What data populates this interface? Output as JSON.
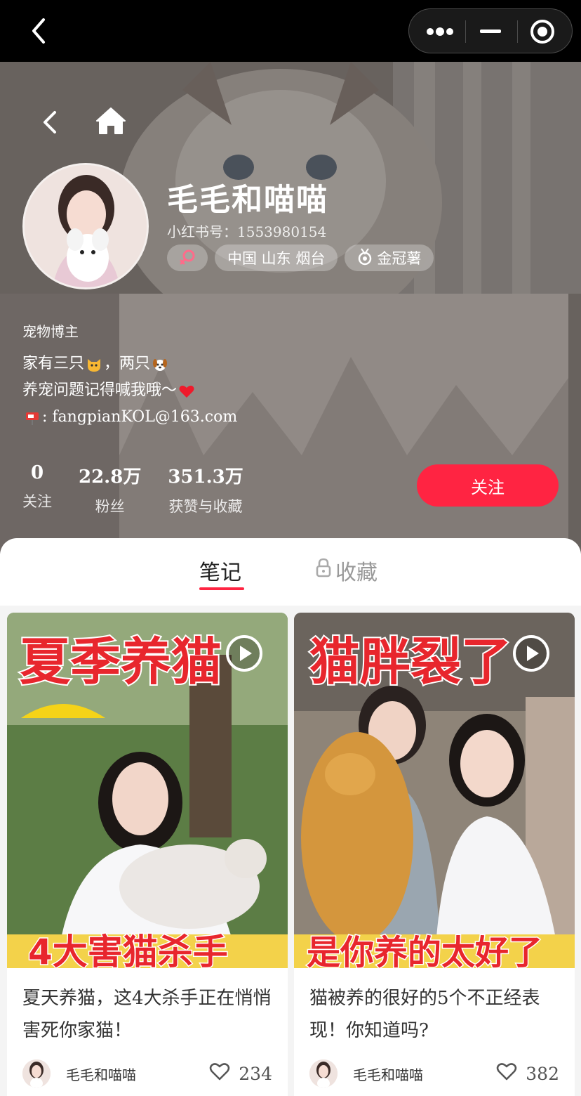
{
  "profile": {
    "nickname": "毛毛和喵喵",
    "red_id": "小红书号：1553980154",
    "location_tag": "中国 山东 烟台",
    "badge_tag": "金冠薯",
    "role": "宠物博主",
    "bio_line1_a": "家有三只",
    "bio_line1_b": "，两只",
    "bio_line2": "养宠问题记得喊我哦～",
    "bio_line3": ": fangpianKOL@163.com",
    "follow_label": "关注"
  },
  "stats": [
    {
      "num": "0",
      "label": "关注"
    },
    {
      "num": "22.8万",
      "label": "粉丝"
    },
    {
      "num": "351.3万",
      "label": "获赞与收藏"
    }
  ],
  "tabs": {
    "notes": "笔记",
    "collections": "收藏"
  },
  "notes": [
    {
      "cover_headline": "夏季养猫",
      "cover_bottom": "4大害猫杀手",
      "title": "夏天养猫，这4大杀手正在悄悄害死你家猫！",
      "author": "毛毛和喵喵",
      "likes": "234"
    },
    {
      "cover_headline": "猫胖裂了",
      "cover_bottom": "是你养的太好了",
      "title": "猫被养的很好的5个不正经表现！你知道吗?",
      "author": "毛毛和喵喵",
      "likes": "382"
    }
  ],
  "colors": {
    "accent": "#ff2442",
    "topbar": "#000000",
    "cover_text_red": "#e8262d",
    "cover_text_yellow": "#ffd83a"
  },
  "icons": [
    "back-icon",
    "more-icon",
    "minimize-icon",
    "close-target-icon",
    "home-icon",
    "gender-female-icon",
    "medal-icon",
    "lock-icon",
    "play-icon",
    "heart-icon"
  ]
}
